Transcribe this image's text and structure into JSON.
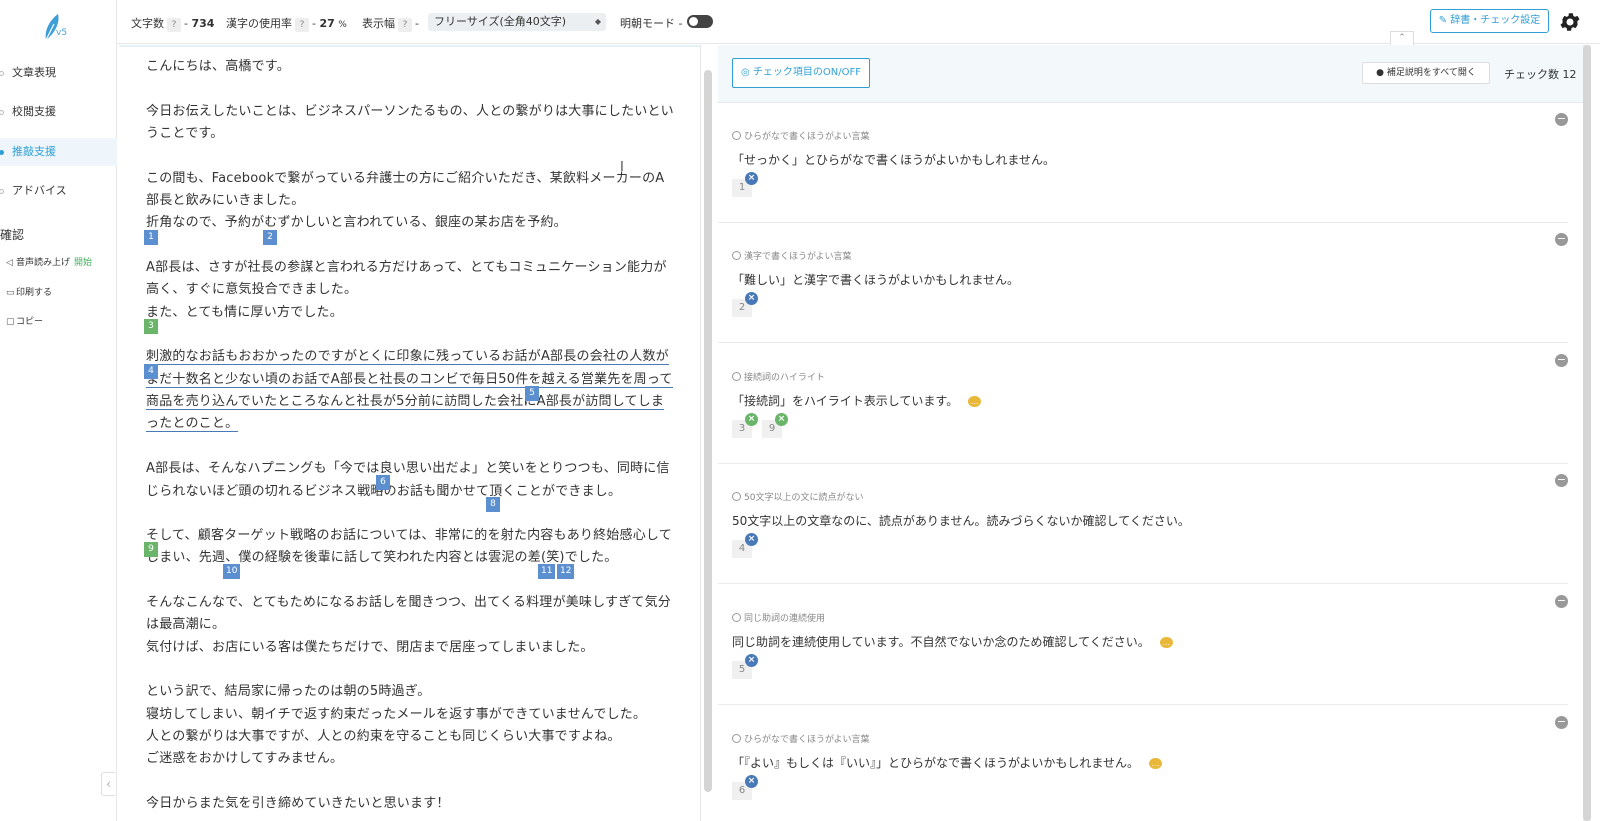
{
  "sidebar": {
    "version": "v5",
    "nav": [
      {
        "label": "文章表現"
      },
      {
        "label": "校閲支援"
      },
      {
        "label": "推敲支援"
      },
      {
        "label": "アドバイス"
      }
    ],
    "section_title": "確認",
    "read_aloud": "音声読み上げ",
    "read_aloud_start": "開始",
    "print": "印刷する",
    "copy": "コピー",
    "collapse": "‹"
  },
  "topbar": {
    "char_count_label": "文字数",
    "char_count_value": "734",
    "kanji_label": "漢字の使用率",
    "kanji_value": "27",
    "kanji_unit": "%",
    "width_label": "表示幅",
    "width_select": "フリーサイズ(全角40文字)",
    "mincho_label": "明朝モード",
    "dict_button": "辞書・チェック設定",
    "q": "?",
    "dash": "-"
  },
  "editor": {
    "lines": [
      "こんにちは、高橋です。",
      "今日お伝えしたいことは、ビジネスパーソンたるもの、人との繋がりは大事にしたいとい",
      "うことです。",
      "この間も、Facebookで繋がっている弁護士の方にご紹介いただき、某飲料メーカーのA",
      "部長と飲みにいきました。",
      "折角なので、予約がむずかしいと言われている、銀座の某お店を予約。",
      "A部長は、さすが社長の参謀と言われる方だけあって、とてもコミュニケーション能力が",
      "高く、すぐに意気投合できました。",
      "また、とても情に厚い方でした。",
      "刺激的なお話もおおかったのですがとくに印象に残っているお話がA部長の会社の人数が",
      "まだ十数名と少ない頃のお話でA部長と社長のコンビで毎日50件を越える営業先を周って",
      "商品を売り込んでいたところなんと社長が5分前に訪問した会社にA部長が訪問してしま",
      "ったとのこと。",
      "A部長は、そんなハプニングも「今では良い思い出だよ」と笑いをとりつつも、同時に信",
      "じられないほど頭の切れるビジネス戦略のお話も聞かせて頂くことができまし。",
      "そして、顧客ターゲット戦略のお話については、非常に的を射た内容もあり終始感心して",
      "しまい、先週、僕の経験を後輩に話して笑われた内容とは雲泥の差(笑)でした。",
      "そんなこんなで、とてもためになるお話しを聞きつつ、出てくる料理が美味しすぎて気分",
      "は最高潮に。",
      "気付けば、お店にいる客は僕たちだけで、閉店まで居座ってしまいました。",
      "という訳で、結局家に帰ったのは朝の5時過ぎ。",
      "寝坊してしまい、朝イチで返す約束だったメールを返す事ができていませんでした。",
      "人との繋がりは大事ですが、人との約束を守ることも同じくらい大事ですよね。",
      "ご迷惑をおかけしてすみません。",
      "今日からまた気を引き締めていきたいと思います！"
    ],
    "markers": [
      "1",
      "2",
      "3",
      "4",
      "5",
      "6",
      "8",
      "9",
      "10",
      "11",
      "12"
    ]
  },
  "panel": {
    "toggle_button": "チェック項目のON/OFF",
    "open_all_button": "補足説明をすべて開く",
    "check_count_label": "チェック数",
    "check_count_value": "12",
    "cards": [
      {
        "category": "ひらがなで書くほうがよい言葉",
        "message": "「せっかく」とひらがなで書くほうがよいかもしれません。",
        "tags": [
          "1"
        ]
      },
      {
        "category": "漢字で書くほうがよい言葉",
        "message": "「難しい」と漢字で書くほうがよいかもしれません。",
        "tags": [
          "2"
        ]
      },
      {
        "category": "接続詞のハイライト",
        "message": "「接続詞」をハイライト表示しています。",
        "tags": [
          "3",
          "9"
        ]
      },
      {
        "category": "50文字以上の文に読点がない",
        "message": "50文字以上の文章なのに、読点がありません。読みづらくないか確認してください。",
        "tags": [
          "4"
        ]
      },
      {
        "category": "同じ助詞の連続使用",
        "message": "同じ助詞を連続使用しています。不自然でないか念のため確認してください。",
        "tags": [
          "5"
        ]
      },
      {
        "category": "ひらがなで書くほうがよい言葉",
        "message": "「『よい』もしくは『いい』」とひらがなで書くほうがよいかもしれません。",
        "tags": [
          "6"
        ]
      }
    ]
  },
  "colors": {
    "accent": "#2f9fd6",
    "marker_blue": "#5b8fd0",
    "marker_green": "#6bb56b"
  }
}
